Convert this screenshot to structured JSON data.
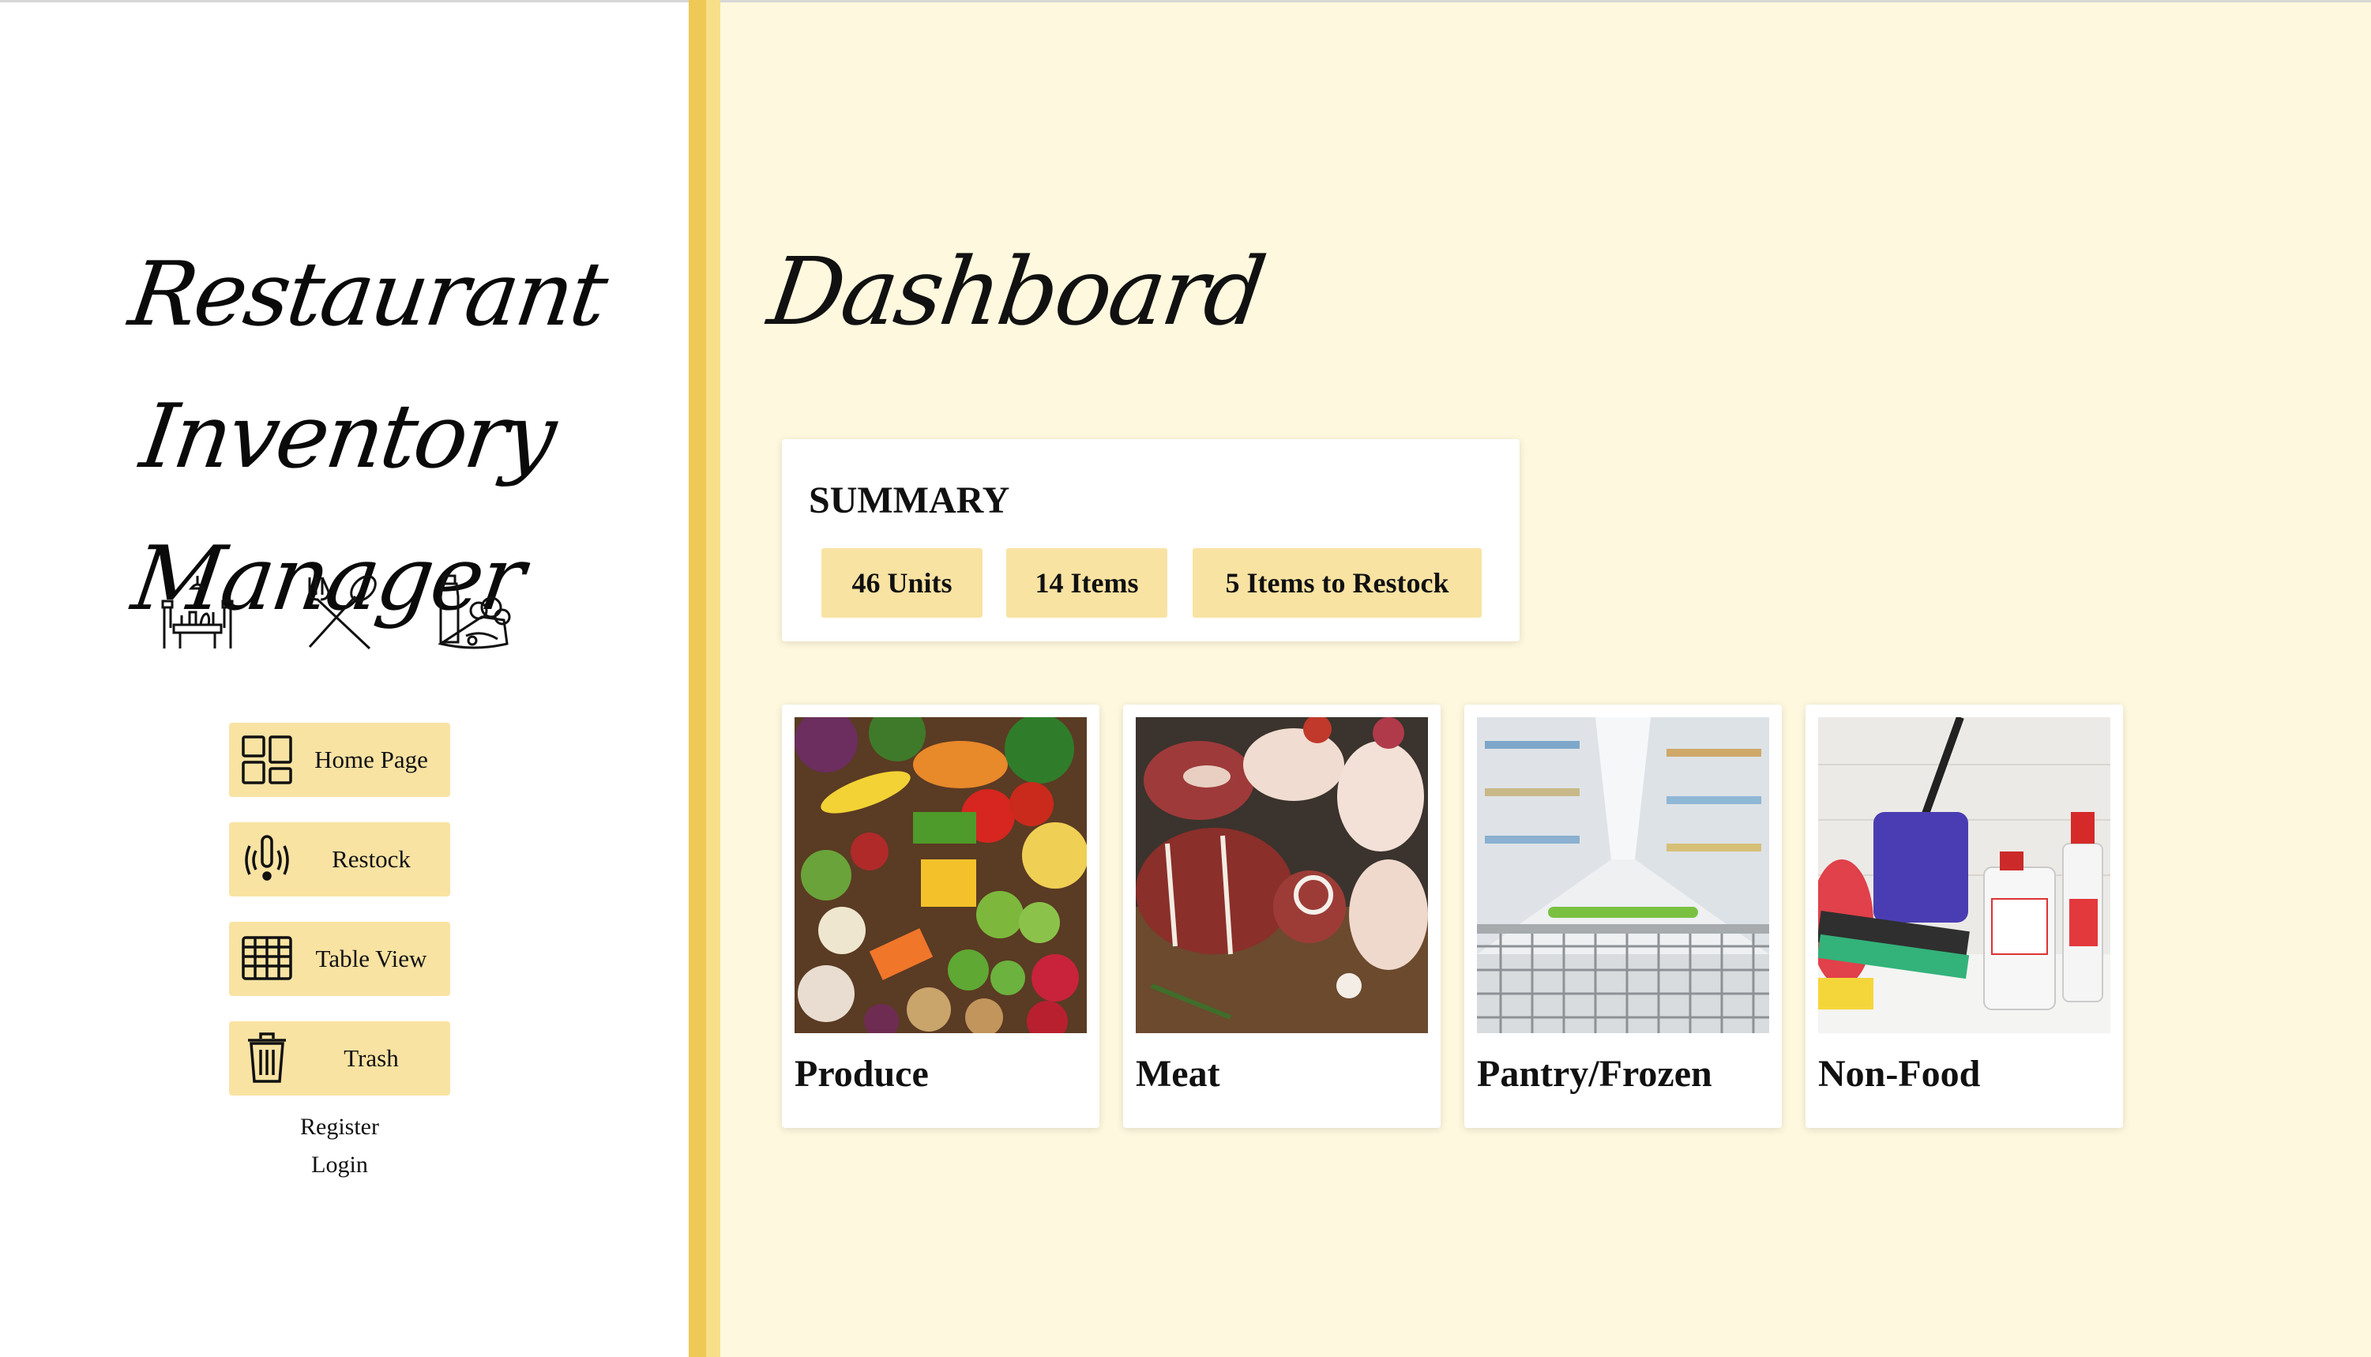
{
  "app": {
    "title_line1": "Restaurant Inventory",
    "title_line2": "Manager"
  },
  "header_icons": [
    "dining-table-icon",
    "fork-spoon-icon",
    "grocery-bag-icon"
  ],
  "nav": {
    "items": [
      {
        "label": "Home Page",
        "icon": "dashboard-grid-icon"
      },
      {
        "label": "Restock",
        "icon": "alert-signal-icon"
      },
      {
        "label": "Table View",
        "icon": "table-grid-icon"
      },
      {
        "label": "Trash",
        "icon": "trash-icon"
      }
    ],
    "register_label": "Register",
    "login_label": "Login"
  },
  "main": {
    "title": "Dashboard",
    "summary": {
      "heading": "SUMMARY",
      "units": "46 Units",
      "items": "14 Items",
      "restock": "5 Items to Restock"
    },
    "categories": [
      {
        "label": "Produce"
      },
      {
        "label": "Meat"
      },
      {
        "label": "Pantry/Frozen"
      },
      {
        "label": "Non-Food"
      }
    ]
  },
  "colors": {
    "accent": "#f9e3a3",
    "background": "#fef8de",
    "divider": "#efc955"
  }
}
